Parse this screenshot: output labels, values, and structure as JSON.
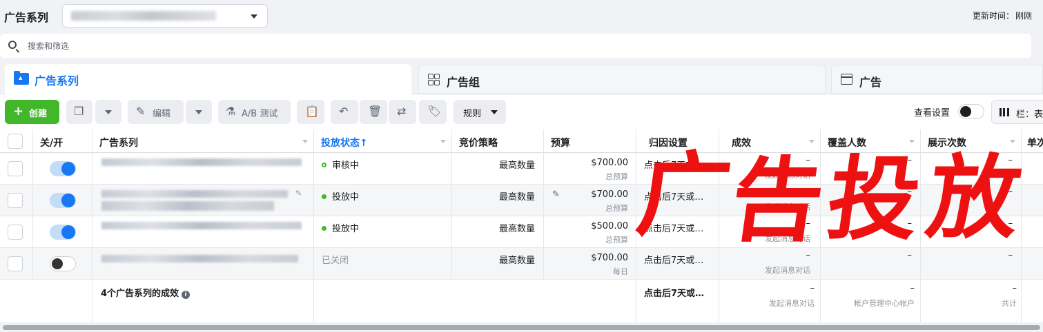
{
  "header": {
    "title": "广告系列",
    "update_label": "更新时间：",
    "update_value": "刚刚"
  },
  "search": {
    "placeholder": "搜索和筛选"
  },
  "tabs": [
    {
      "label": "广告系列",
      "icon": "folder-icon",
      "active": true
    },
    {
      "label": "广告组",
      "icon": "grid-icon",
      "active": false
    },
    {
      "label": "广告",
      "icon": "ad-icon",
      "active": false
    }
  ],
  "toolbar": {
    "create_label": "创建",
    "edit_label": "编辑",
    "ab_test_label": "A/B 测试",
    "rules_label": "规则",
    "view_settings_label": "查看设置",
    "columns_label": "栏：表"
  },
  "columns": [
    "关/开",
    "广告系列",
    "投放状态↑",
    "竞价策略",
    "预算",
    "归因设置",
    "成效",
    "覆盖人数",
    "展示次数",
    "单次"
  ],
  "rows": [
    {
      "on": true,
      "status": "审核中",
      "bid": "最高数量",
      "budget": "$700.00",
      "budget_type": "总预算",
      "attribution": "点击后7天或…",
      "result": "–",
      "result_sub": "发起消息对话",
      "reach": "–",
      "impressions": "–"
    },
    {
      "on": true,
      "status": "投放中",
      "bid": "最高数量",
      "budget": "$700.00",
      "budget_type": "总预算",
      "attribution": "点击后7天或…",
      "result": "–",
      "result_sub": "发起消息对话",
      "reach": "–",
      "impressions": "–"
    },
    {
      "on": true,
      "status": "投放中",
      "bid": "最高数量",
      "budget": "$500.00",
      "budget_type": "总预算",
      "attribution": "点击后7天或…",
      "result": "–",
      "result_sub": "发起消息对话",
      "reach": "–",
      "impressions": "–"
    },
    {
      "on": false,
      "status": "已关闭",
      "bid": "最高数量",
      "budget": "$700.00",
      "budget_type": "每日",
      "attribution": "点击后7天或…",
      "result": "–",
      "result_sub": "发起消息对话",
      "reach": "–",
      "impressions": "–"
    }
  ],
  "summary": {
    "title": "4个广告系列的成效",
    "attribution": "点击后7天或…",
    "result": "–",
    "result_sub": "发起消息对话",
    "reach": "–",
    "reach_sub": "帐户管理中心帐户",
    "impressions": "–",
    "impressions_sub": "共计"
  },
  "watermark": {
    "text": [
      "广",
      "告",
      "投",
      "放"
    ],
    "color": "#ee1111"
  },
  "colors": {
    "accent": "#1877f2",
    "create": "#42b72a",
    "active_status": "#42b72a"
  }
}
